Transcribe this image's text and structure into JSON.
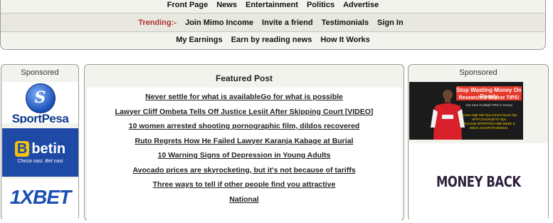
{
  "nav": {
    "row1": [
      "Front Page",
      "News",
      "Entertainment",
      "Politics",
      "Advertise"
    ],
    "row2_trending": "Trending:-",
    "row2": [
      "Join Mimo Income",
      "Invite a friend",
      "Testimonials",
      "Sign In"
    ],
    "row3": [
      "My Earnings",
      "Earn by reading news",
      "How It Works"
    ]
  },
  "left": {
    "title": "Sponsored",
    "ads": {
      "sportpesa": "SportPesa",
      "betin": "betin",
      "betin_sub": "Cheza nasi. Bet nasi",
      "onexbet": "1XBET"
    }
  },
  "center": {
    "title": "Featured Post",
    "posts": [
      "Never settle for what is availableGo for what is possible",
      "Lawyer Cliff Ombeta Tells Off Justice Lesiit After Skipping Court [VIDEO]",
      "10 women arrested shooting pornographic film, dildos recovered",
      "Ruto Regrets How He Failed Lawyer Karanja Kabage at Burial",
      "10 Warning Signs of Depression in Young Adults",
      "Avocado prices are skyrocketing, but it's not because of tariffs",
      "Three ways to tell if other people find you attractive",
      "National"
    ]
  },
  "right": {
    "title": "Sponsored",
    "ad": {
      "headline": "Stop Wasting Money On Poorly",
      "line2": "Researched Soccer TIPS!",
      "line3": "Get Sure Football TIPS In Kenya",
      "fine1": "Access High Odd Tips,Correct Score Tips",
      "fine2": "HF/FT,OV/UN,BTTS Tips",
      "fine3": "Plus texts SPORTPESA MID-WEEK &",
      "fine4": "MEGA JACKPOTS BONUS."
    },
    "moneyback": "MONEY BACK"
  }
}
